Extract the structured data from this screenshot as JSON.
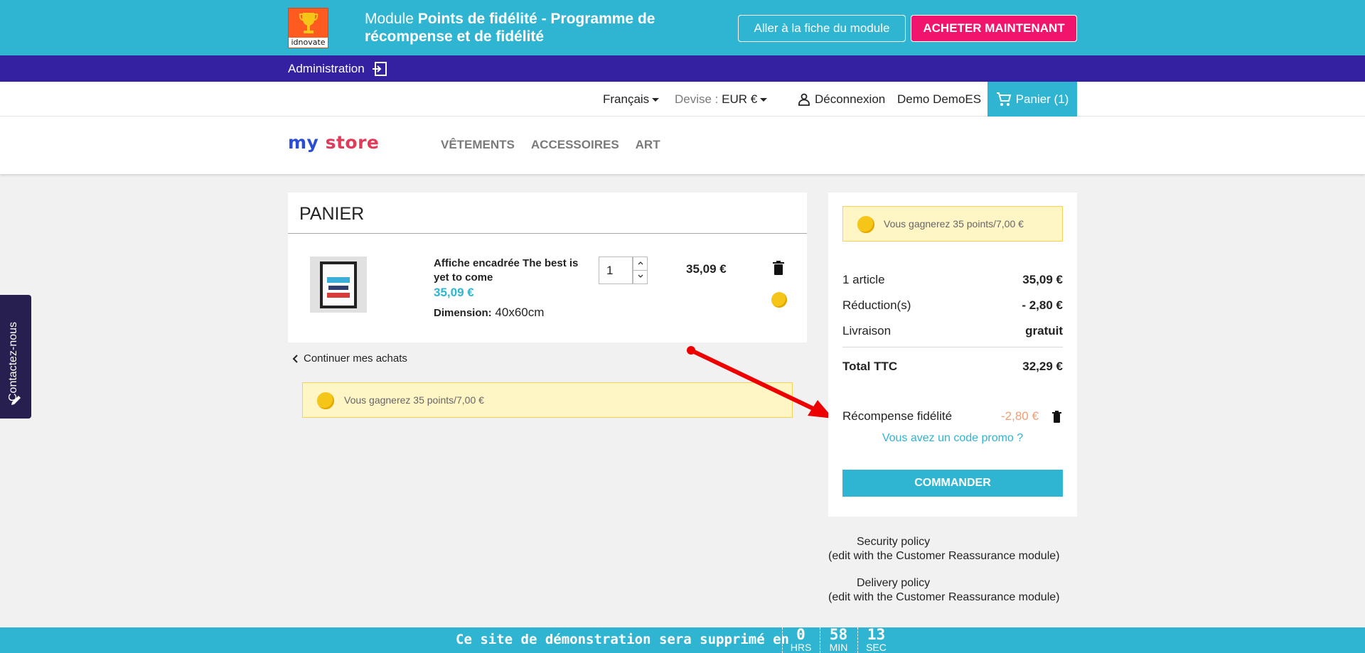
{
  "module_bar": {
    "logo_text": "idnovate",
    "title_prefix": "Module ",
    "title_bold": "Points de fidélité - Programme de récompense et de fidélité",
    "sheet_button": "Aller à la fiche du module",
    "buy_button": "ACHETER MAINTENANT"
  },
  "admin_bar": {
    "label": "Administration"
  },
  "header_nav": {
    "language": "Français",
    "currency_label": "Devise : ",
    "currency_value": "EUR €",
    "logout": "Déconnexion",
    "account": "Demo DemoES",
    "cart": "Panier (1)"
  },
  "store": {
    "logo_my": "my",
    "logo_store": "store",
    "menu": [
      "VÊTEMENTS",
      "ACCESSOIRES",
      "ART"
    ]
  },
  "cart": {
    "title": "PANIER",
    "item": {
      "name": "Affiche encadrée The best is yet to come",
      "price": "35,09 €",
      "attr_label": "Dimension:",
      "attr_value": "40x60cm",
      "quantity": "1",
      "total": "35,09 €"
    },
    "continue": "Continuer mes achats",
    "points_message": "Vous gagnerez 35 points/7,00 €"
  },
  "summary": {
    "points_message": "Vous gagnerez 35 points/7,00 €",
    "rows": [
      {
        "label": "1 article",
        "value": "35,09 €"
      },
      {
        "label": "Réduction(s)",
        "value": "- 2,80 €"
      },
      {
        "label": "Livraison",
        "value": "gratuit"
      }
    ],
    "total_label": "Total TTC",
    "total_value": "32,29 €",
    "reward_label": "Récompense fidélité",
    "reward_value": "-2,80 €",
    "promo_link": "Vous avez un code promo ?",
    "order_button": "COMMANDER"
  },
  "reassurance": [
    {
      "title": "Security policy",
      "body": "(edit with the Customer Reassurance module)"
    },
    {
      "title": "Delivery policy",
      "body": "(edit with the Customer Reassurance module)"
    }
  ],
  "contact_tab": {
    "label": "Contactez-nous"
  },
  "countdown": {
    "text": "Ce site de démonstration sera supprimé en",
    "hours": "0",
    "hours_unit": "HRS",
    "minutes": "58",
    "minutes_unit": "MIN",
    "seconds": "13",
    "seconds_unit": "SEC"
  },
  "colors": {
    "brand": "#2fb5d2",
    "admin": "#3421a1",
    "buy": "#f0146c",
    "reward": "#f39d72",
    "points_bg": "#fff5c5"
  }
}
